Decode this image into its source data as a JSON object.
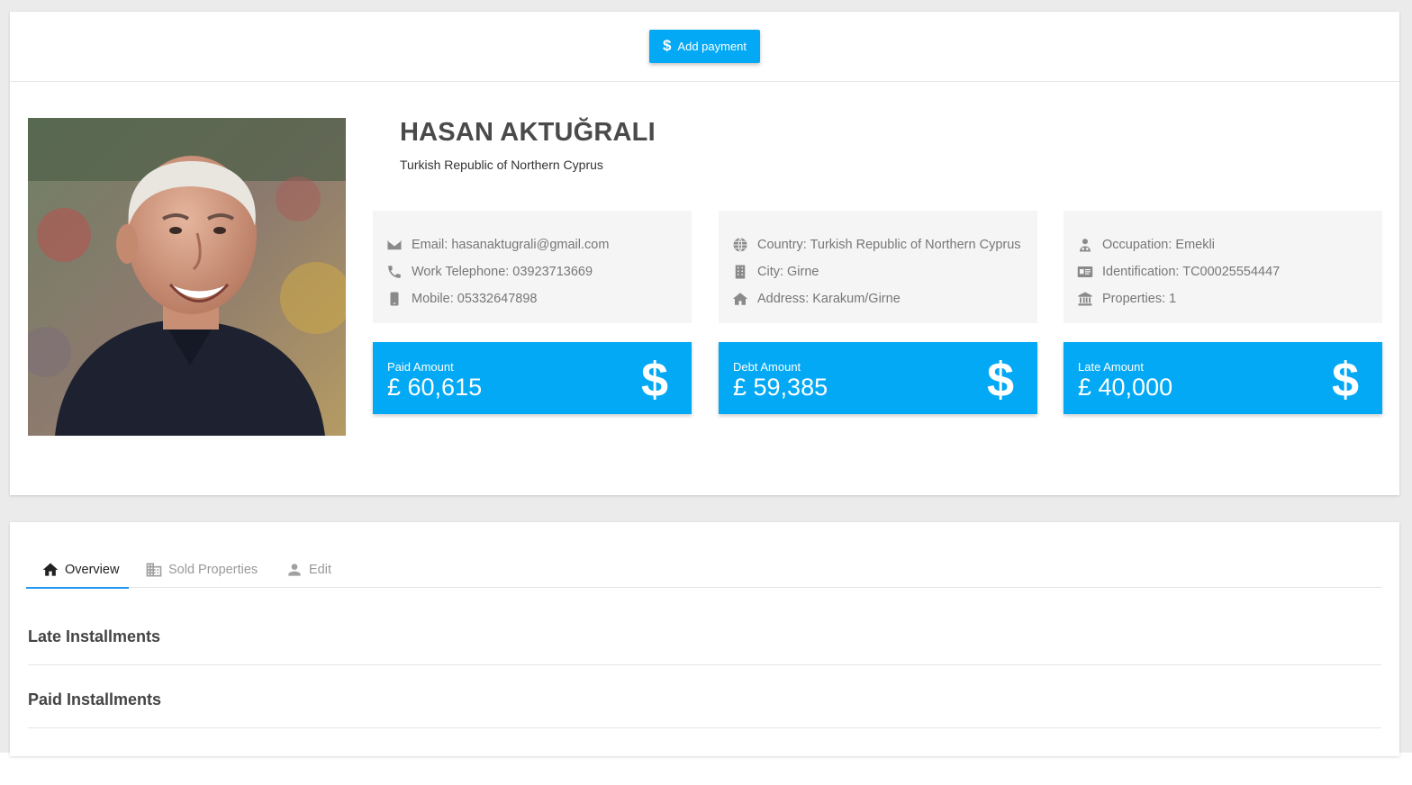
{
  "toolbar": {
    "add_payment_label": "Add payment",
    "add_payment_icon": "dollar-icon"
  },
  "profile": {
    "name": "HASAN AKTUĞRALI",
    "country": "Turkish Republic of Northern Cyprus",
    "photo_alt": "profile photo"
  },
  "contact": {
    "email": "Email: hasanaktugrali@gmail.com",
    "work_phone": "Work Telephone: 03923713669",
    "mobile": "Mobile: 05332647898"
  },
  "location": {
    "country": "Country: Turkish Republic of Northern Cyprus",
    "city": "City: Girne",
    "address": "Address: Karakum/Girne"
  },
  "details": {
    "occupation": "Occupation: Emekli",
    "identification": "Identification: TC00025554447",
    "properties": "Properties: 1"
  },
  "stats": {
    "paid": {
      "label": "Paid Amount",
      "value": "£ 60,615"
    },
    "debt": {
      "label": "Debt Amount",
      "value": "£ 59,385"
    },
    "late": {
      "label": "Late Amount",
      "value": "£ 40,000"
    }
  },
  "tabs": [
    {
      "label": "Overview",
      "icon": "home-icon",
      "active": true
    },
    {
      "label": "Sold Properties",
      "icon": "building-icon",
      "active": false
    },
    {
      "label": "Edit",
      "icon": "person-icon",
      "active": false
    }
  ],
  "sections": {
    "late_title": "Late Installments",
    "paid_title": "Paid Installments"
  },
  "colors": {
    "accent": "#03a9f4",
    "tab_indicator": "#2196f3",
    "info_box_bg": "#f5f5f5",
    "page_bg": "#ebebeb"
  }
}
